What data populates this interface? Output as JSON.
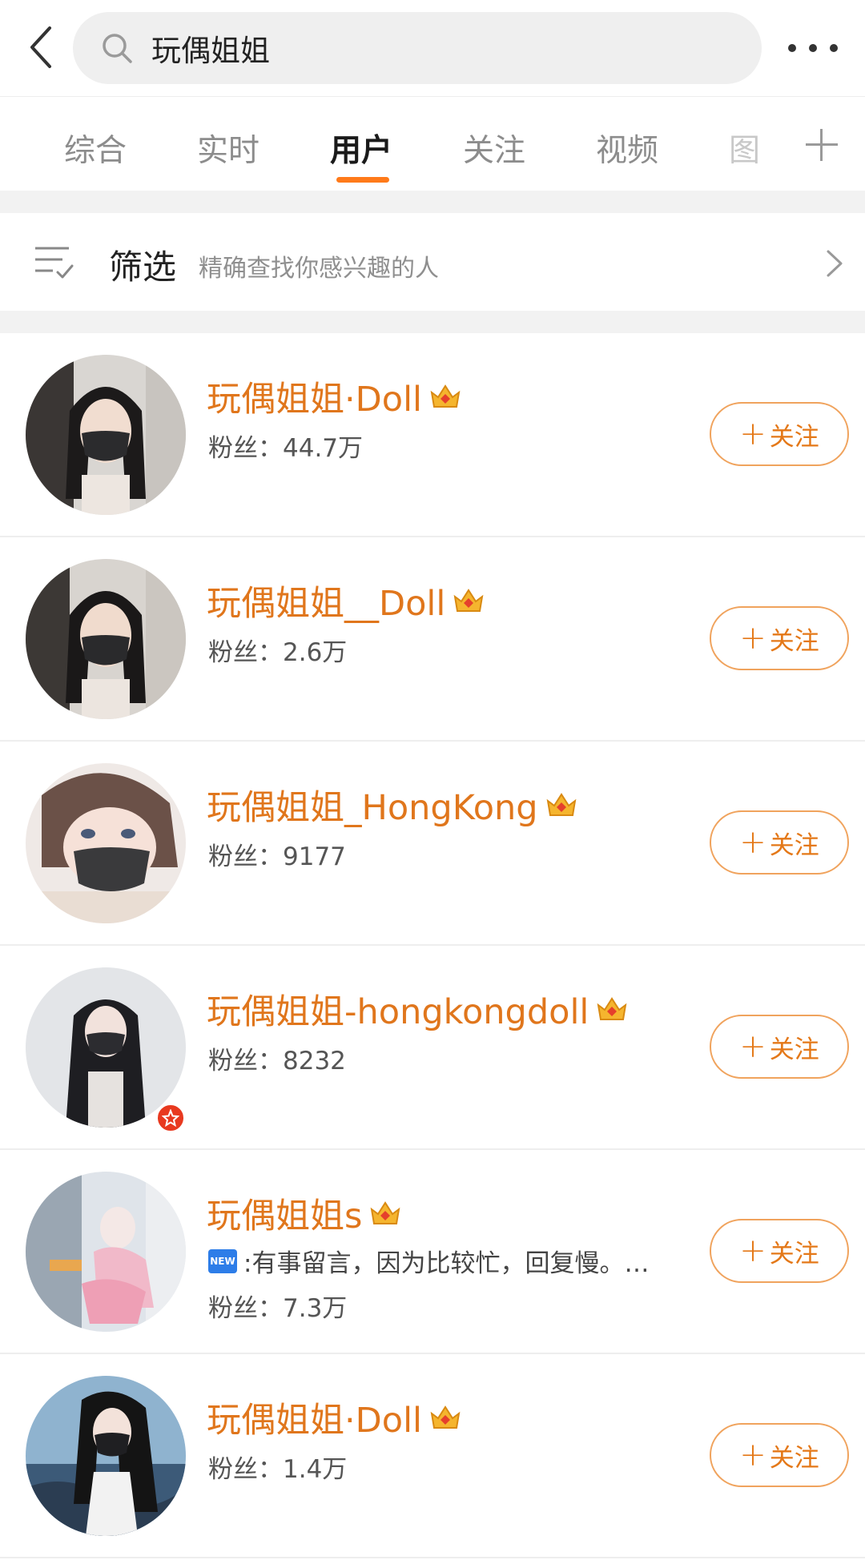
{
  "search": {
    "query": "玩偶姐姐"
  },
  "tabs": [
    {
      "label": "综合"
    },
    {
      "label": "实时"
    },
    {
      "label": "用户"
    },
    {
      "label": "关注"
    },
    {
      "label": "视频"
    },
    {
      "label": "图"
    }
  ],
  "active_tab": "用户",
  "filter": {
    "label": "筛选",
    "description": "精确查找你感兴趣的人"
  },
  "follow_label": "关注",
  "follow_plus": "+",
  "users": [
    {
      "name": "玩偶姐姐·Doll",
      "fans": "粉丝：44.7万"
    },
    {
      "name": "玩偶姐姐__Doll",
      "fans": "粉丝：2.6万"
    },
    {
      "name": "玩偶姐姐_HongKong",
      "fans": "粉丝：9177"
    },
    {
      "name": "玩偶姐姐-hongkongdoll",
      "fans": "粉丝：8232"
    },
    {
      "name": "玩偶姐姐s",
      "bio": ":有事留言，因为比较忙，回复慢。…",
      "bio_tag": "NEW",
      "fans": "粉丝：7.3万"
    },
    {
      "name": "玩偶姐姐·Doll",
      "fans": "粉丝：1.4万"
    }
  ],
  "colors": {
    "accent": "#ff7a1a",
    "name": "#e0761c",
    "follow_border": "#f0a35d"
  }
}
